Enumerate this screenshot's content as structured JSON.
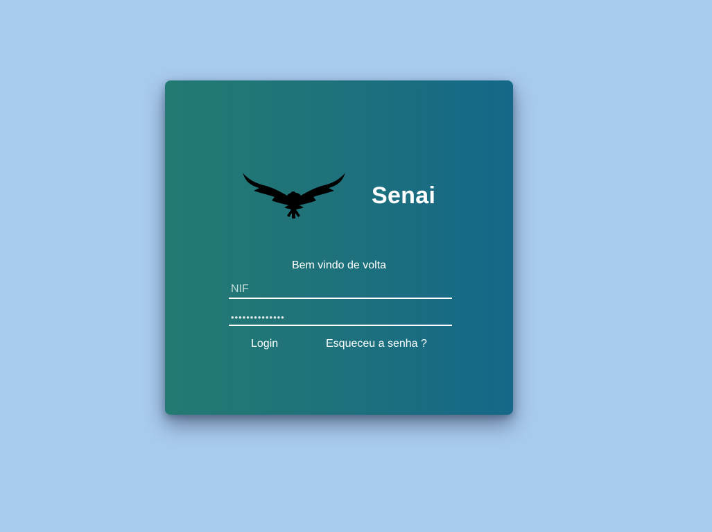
{
  "brand": {
    "logo_icon": "eagle-icon",
    "name": "Senai"
  },
  "form": {
    "welcome_text": "Bem vindo de volta",
    "nif_placeholder": "NIF",
    "nif_value": "",
    "password_value": "••••••••••••••",
    "login_label": "Login",
    "forgot_label": "Esqueceu a senha ?"
  },
  "colors": {
    "page_background": "#a9cbef",
    "card_gradient_start": "#237a72",
    "card_gradient_end": "#156888",
    "text": "#ffffff",
    "logo": "#000000"
  }
}
